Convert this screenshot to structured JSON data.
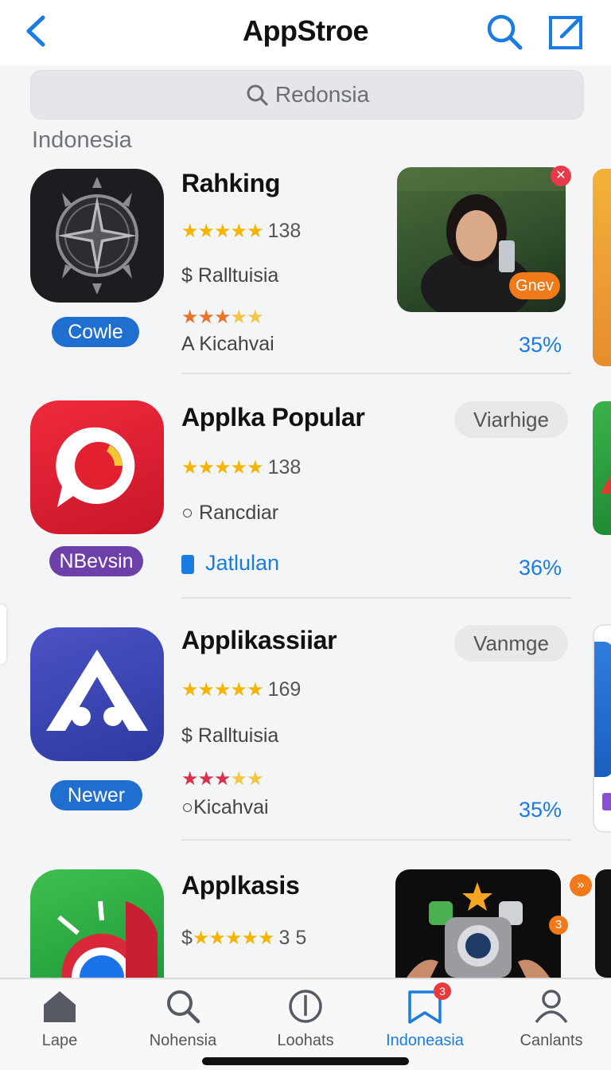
{
  "header": {
    "title": "AppStroe",
    "back_icon": "chevron-left-icon",
    "search_icon": "search-icon",
    "compose_icon": "compose-icon",
    "accent": "#1a7be0"
  },
  "search": {
    "placeholder": "Redonsia"
  },
  "section": {
    "label": "Indonesia"
  },
  "apps": [
    {
      "name": "Rahking",
      "rating_count": "138",
      "line2": "Ralltuisia",
      "line2_icon": "dollar-icon",
      "line3": "A Kicahvai",
      "pill": "Cowle",
      "pill_color": "#1f6fd1",
      "percent": "35%",
      "thumb_label": "Gnev"
    },
    {
      "name": "Applka Popular",
      "rating_count": "138",
      "line2": "Rancdiar",
      "line2_icon": "circle-icon",
      "line3": "Jatlulan",
      "line3_icon": "phone-icon",
      "pill": "NBevsin",
      "pill_color": "#6d3fa8",
      "button": "Viarhige",
      "percent": "36%"
    },
    {
      "name": "Applikassiiar",
      "rating_count": "169",
      "line2": "Ralltuisia",
      "line2_icon": "dollar-icon",
      "line3": "Kicahvai",
      "line3_icon": "circle-icon",
      "pill": "Newer",
      "pill_color": "#1f6fd1",
      "button": "Vanmge",
      "percent": "35%"
    },
    {
      "name": "Applkasis",
      "rating_count": "3 5",
      "line2_icon": "dollar-icon",
      "thumb_badge": "3"
    }
  ],
  "tabs": [
    {
      "label": "Lapе",
      "icon": "home-icon"
    },
    {
      "label": "Nohensia",
      "icon": "search-icon"
    },
    {
      "label": "Loohats",
      "icon": "clock-icon"
    },
    {
      "label": "Indoneasia",
      "icon": "bookmark-icon",
      "badge": "3",
      "active": true
    },
    {
      "label": "Canlants",
      "icon": "person-icon"
    }
  ]
}
